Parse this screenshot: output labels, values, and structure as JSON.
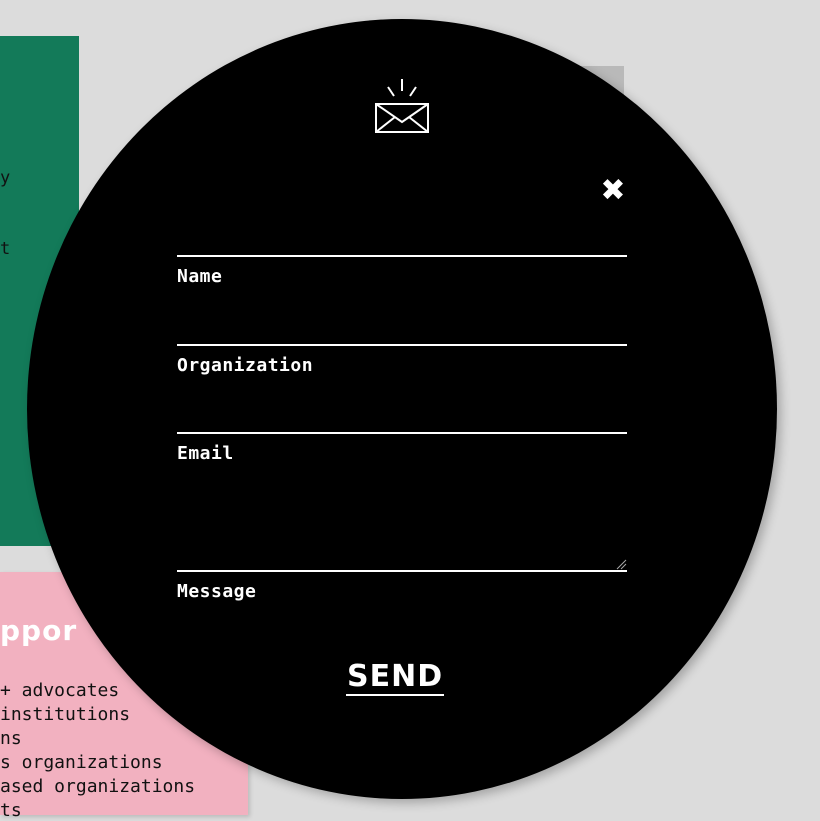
{
  "background": {
    "green_card": {
      "fragments": [
        "y",
        "t"
      ]
    },
    "pink_card": {
      "heading": "ppor",
      "lines": [
        " + advocates",
        "institutions",
        "ns",
        "s organizations",
        "ased organizations",
        "ts"
      ]
    }
  },
  "modal": {
    "icon": "envelope-icon",
    "close_icon": "close-icon",
    "close_symbol": "✖",
    "fields": {
      "name": {
        "label": "Name",
        "value": ""
      },
      "organization": {
        "label": "Organization",
        "value": ""
      },
      "email": {
        "label": "Email",
        "value": ""
      },
      "message": {
        "label": "Message",
        "value": ""
      }
    },
    "send_label": "SEND"
  },
  "colors": {
    "page_bg": "#dcdcdc",
    "green": "#137a59",
    "pink": "#f2b1c0",
    "modal_bg": "#000000",
    "modal_fg": "#ffffff"
  }
}
